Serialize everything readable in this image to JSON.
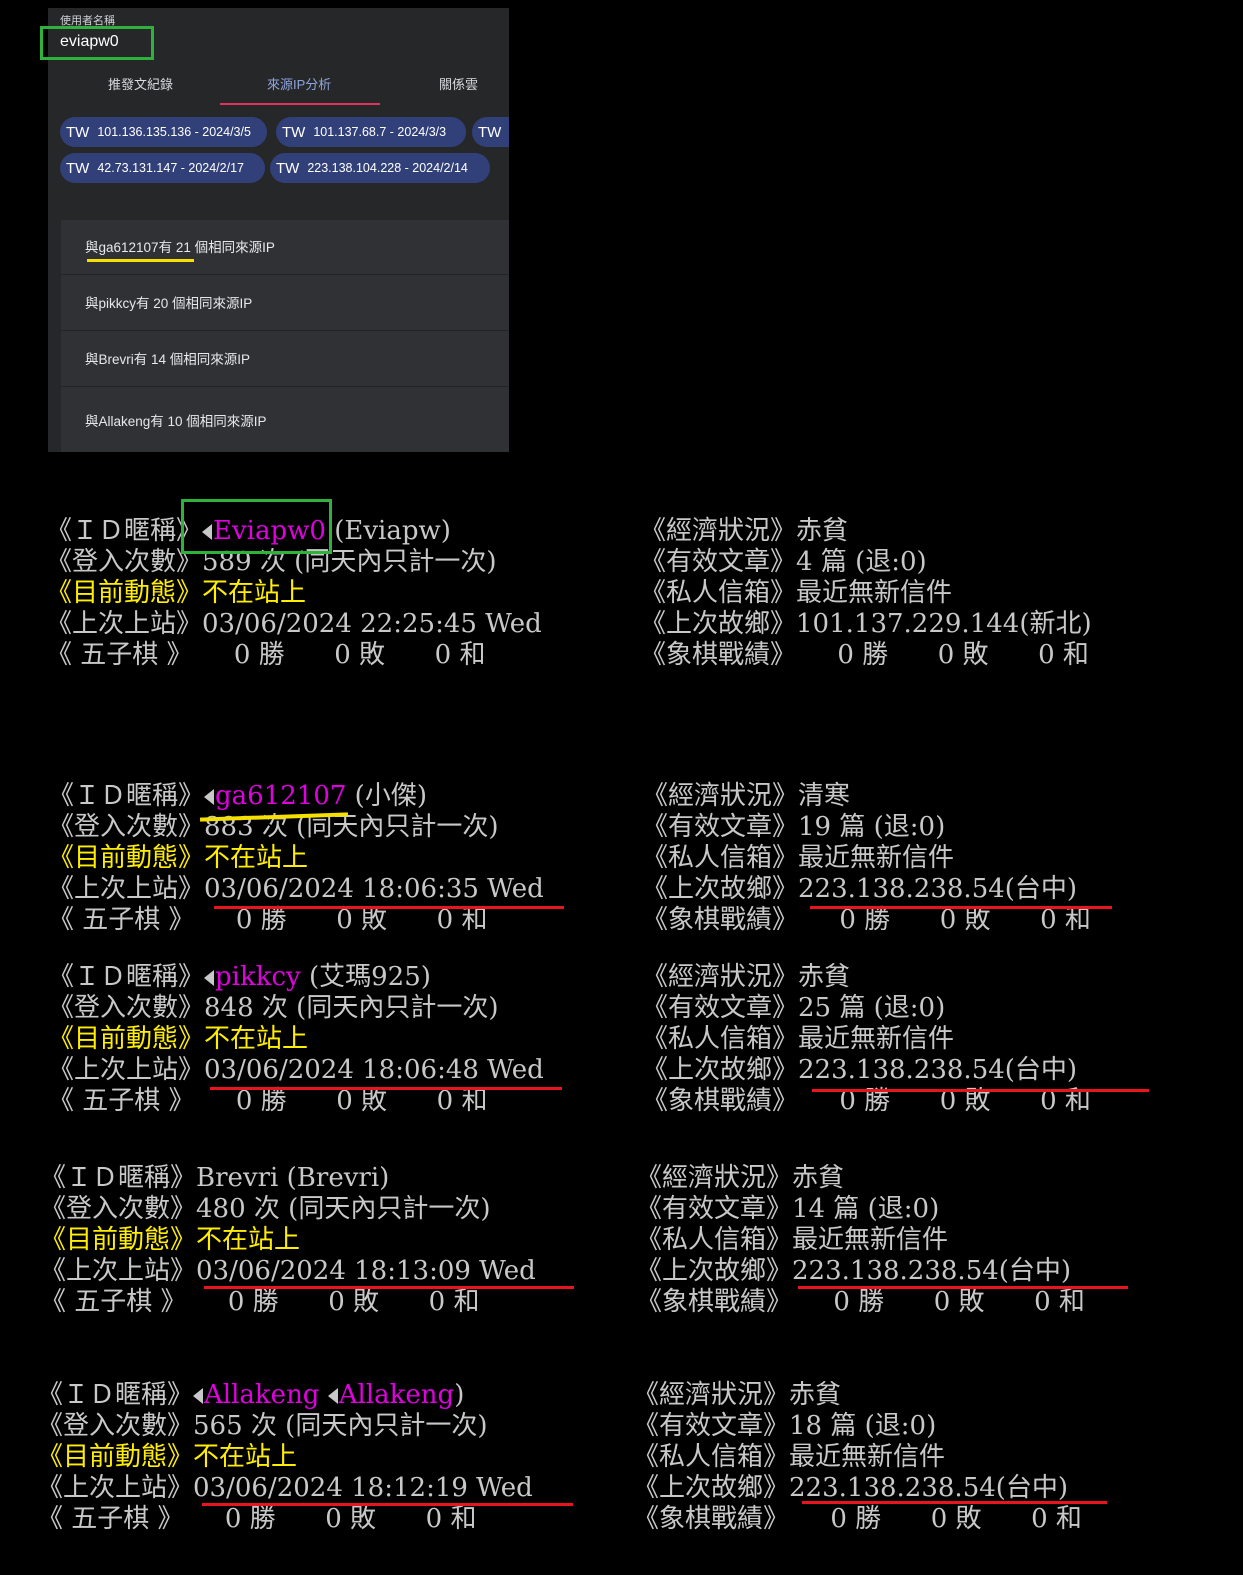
{
  "panel": {
    "username_label": "使用者名稱",
    "username_value": "eviapw0",
    "tabs": [
      "推發文紀錄",
      "來源IP分析",
      "關係雲"
    ],
    "active_tab": "來源IP分析",
    "ip_chips": [
      {
        "cc": "TW",
        "text": "101.136.135.136 - 2024/3/5"
      },
      {
        "cc": "TW",
        "text": "101.137.68.7 - 2024/3/3"
      },
      {
        "cc": "TW",
        "text": ""
      },
      {
        "cc": "TW",
        "text": "42.73.131.147 - 2024/2/17"
      },
      {
        "cc": "TW",
        "text": "223.138.104.228 - 2024/2/14"
      }
    ],
    "peers": [
      "與ga612107有 21 個相同來源IP",
      "與pikkcy有 20 個相同來源IP",
      "與Brevri有 14 個相同來源IP",
      "與Allakeng有 10 個相同來源IP"
    ]
  },
  "labels": {
    "id": "《ＩＤ暱稱》",
    "logins": "《登入次數》",
    "status": "《目前動態》",
    "last_login": "《上次上站》",
    "gomoku": "《 五子棋 》",
    "economy": "《經濟狀況》",
    "posts": "《有效文章》",
    "mailbox": "《私人信箱》",
    "last_host": "《上次故鄉》",
    "chess": "《象棋戰績》"
  },
  "profiles": [
    {
      "id": "Eviapw0",
      "nick": " (Eviapw)",
      "logins": "589 次 (同天內只計一次)",
      "status": "不在站上",
      "last_login": "03/06/2024 22:25:45 Wed",
      "gomoku": "     0 勝      0 敗      0 和",
      "economy": "赤貧",
      "posts": "4 篇 (退:0)",
      "mailbox": "最近無新信件",
      "last_host": "101.137.229.144(新北)",
      "chess": "     0 勝      0 敗      0 和"
    },
    {
      "id": "ga612107",
      "nick": " (小傑)",
      "logins": "883 次 (同天內只計一次)",
      "status": "不在站上",
      "last_login": "03/06/2024 18:06:35 Wed",
      "gomoku": "     0 勝      0 敗      0 和",
      "economy": "清寒",
      "posts": "19 篇 (退:0)",
      "mailbox": "最近無新信件",
      "last_host": "223.138.238.54(台中)",
      "chess": "     0 勝      0 敗      0 和"
    },
    {
      "id": "pikkcy",
      "nick": " (艾瑪925)",
      "logins": "848 次 (同天內只計一次)",
      "status": "不在站上",
      "last_login": "03/06/2024 18:06:48 Wed",
      "gomoku": "     0 勝      0 敗      0 和",
      "economy": "赤貧",
      "posts": "25 篇 (退:0)",
      "mailbox": "最近無新信件",
      "last_host": "223.138.238.54(台中)",
      "chess": "     0 勝      0 敗      0 和"
    },
    {
      "id": "Brevri",
      "nick": " (Brevri)",
      "logins": "480 次 (同天內只計一次)",
      "status": "不在站上",
      "last_login": "03/06/2024 18:13:09 Wed",
      "gomoku": "     0 勝      0 敗      0 和",
      "economy": "赤貧",
      "posts": "14 篇 (退:0)",
      "mailbox": "最近無新信件",
      "last_host": "223.138.238.54(台中)",
      "chess": "     0 勝      0 敗      0 和"
    },
    {
      "id": "Allakeng",
      "nick": "Allakeng",
      "logins": "565 次 (同天內只計一次)",
      "status": "不在站上",
      "last_login": "03/06/2024 18:12:19 Wed",
      "gomoku": "     0 勝      0 敗      0 和",
      "economy": "赤貧",
      "posts": "18 篇 (退:0)",
      "mailbox": "最近無新信件",
      "last_host": "223.138.238.54(台中)",
      "chess": "     0 勝      0 敗      0 和"
    }
  ],
  "colors": {
    "highlight_green": "#2eb23c",
    "underline_red": "#e8141e",
    "underline_yellow": "#f5e000",
    "id_magenta": "#e000e0",
    "status_yellow": "#ffee00",
    "chip_bg": "#32407a"
  }
}
